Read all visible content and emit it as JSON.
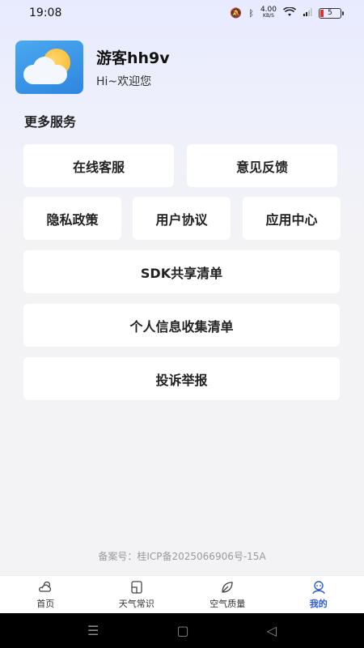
{
  "status_bar": {
    "time": "19:08",
    "net_speed": "4.00",
    "net_unit": "KB/S",
    "battery": "5"
  },
  "profile": {
    "name": "游客hh9v",
    "greeting": "Hi~欢迎您"
  },
  "section_title": "更多服务",
  "services": {
    "online_service": "在线客服",
    "feedback": "意见反馈",
    "privacy_policy": "隐私政策",
    "user_agreement": "用户协议",
    "app_center": "应用中心",
    "sdk_list": "SDK共享清单",
    "personal_info_list": "个人信息收集清单",
    "complaint": "投诉举报"
  },
  "footer_note": "备案号：桂ICP备2025066906号-15A",
  "tabs": [
    {
      "label": "首页",
      "icon": "weather-home-icon"
    },
    {
      "label": "天气常识",
      "icon": "book-icon"
    },
    {
      "label": "空气质量",
      "icon": "leaf-icon"
    },
    {
      "label": "我的",
      "icon": "user-icon",
      "active": true
    }
  ],
  "colors": {
    "accent": "#2a5bd7"
  }
}
